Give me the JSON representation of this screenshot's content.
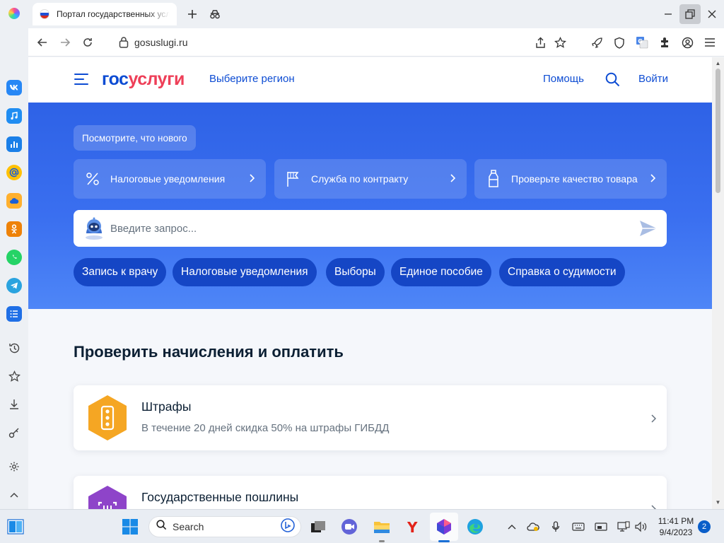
{
  "browser": {
    "tab_title": "Портал государственных услуг",
    "url": "gosuslugi.ru"
  },
  "site": {
    "logo_part1": "гос",
    "logo_part2": "услуги",
    "region_link": "Выберите регион",
    "help_link": "Помощь",
    "login_link": "Войти"
  },
  "hero": {
    "whats_new": "Посмотрите, что нового",
    "promos": [
      {
        "label": "Налоговые уведомления",
        "icon": "percent-icon"
      },
      {
        "label": "Служба по контракту",
        "icon": "flag-icon"
      },
      {
        "label": "Проверьте качество товара",
        "icon": "bottle-icon"
      }
    ],
    "search_placeholder": "Введите запрос...",
    "chips": [
      "Запись к врачу",
      "Налоговые уведомления",
      "Выборы",
      "Единое пособие",
      "Справка о судимости"
    ]
  },
  "payments": {
    "title": "Проверить начисления и оплатить",
    "cards": [
      {
        "title": "Штрафы",
        "subtitle": "В течение 20 дней скидка 50% на штрафы ГИБДД",
        "icon": "traffic-light-icon",
        "color": "#f5a623"
      },
      {
        "title": "Государственные пошлины",
        "subtitle": "",
        "icon": "receipt-icon",
        "color": "#8e44c9"
      }
    ]
  },
  "taskbar": {
    "search_label": "Search",
    "time": "11:41 PM",
    "date": "9/4/2023",
    "notification_count": "2"
  },
  "colors": {
    "brand_blue": "#0d4cd3",
    "brand_red": "#ee3f58",
    "hero_blue": "#3a6ff0"
  }
}
